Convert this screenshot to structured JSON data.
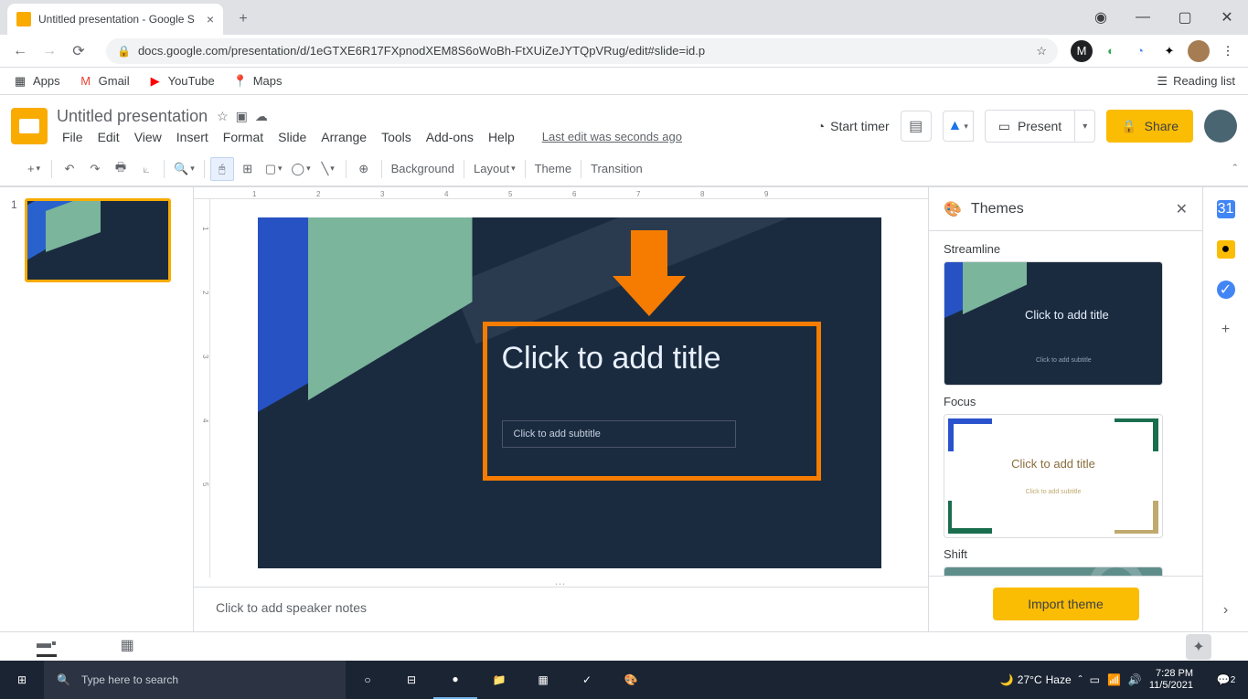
{
  "browser": {
    "tab_title": "Untitled presentation - Google S",
    "url": "docs.google.com/presentation/d/1eGTXE6R17FXpnodXEM8S6oWoBh-FtXUiZeJYTQpVRug/edit#slide=id.p",
    "bookmarks": [
      "Apps",
      "Gmail",
      "YouTube",
      "Maps"
    ],
    "reading_list": "Reading list"
  },
  "doc": {
    "title": "Untitled presentation",
    "last_edit": "Last edit was seconds ago",
    "menus": [
      "File",
      "Edit",
      "View",
      "Insert",
      "Format",
      "Slide",
      "Arrange",
      "Tools",
      "Add-ons",
      "Help"
    ]
  },
  "header_actions": {
    "start_timer": "Start timer",
    "present": "Present",
    "share": "Share"
  },
  "toolbar": {
    "background": "Background",
    "layout": "Layout",
    "theme": "Theme",
    "transition": "Transition"
  },
  "slide": {
    "number": "1",
    "title_placeholder": "Click to add title",
    "subtitle_placeholder": "Click to add subtitle",
    "speaker_notes_placeholder": "Click to add speaker notes"
  },
  "themes_panel": {
    "title": "Themes",
    "streamline": "Streamline",
    "focus": "Focus",
    "shift": "Shift",
    "card_title": "Click to add title",
    "card_subtitle": "Click to add subtitle",
    "import": "Import theme"
  },
  "taskbar": {
    "search_placeholder": "Type here to search",
    "weather_temp": "27°C",
    "weather_cond": "Haze",
    "time": "7:28 PM",
    "date": "11/5/2021",
    "notif_count": "2"
  }
}
